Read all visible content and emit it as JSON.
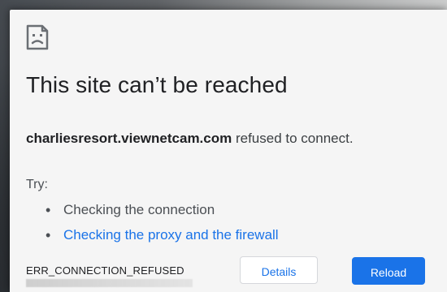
{
  "error_page": {
    "icon": "sad-page-icon",
    "title": "This site can’t be reached",
    "host": "charliesresort.viewnetcam.com",
    "message_suffix": " refused to connect.",
    "try_label": "Try:",
    "suggestions": [
      "Checking the connection",
      "Checking the proxy and the firewall"
    ],
    "error_code": "ERR_CONNECTION_REFUSED",
    "details_button": "Details",
    "reload_button": "Reload"
  },
  "colors": {
    "page_background": "#f5f5f5",
    "link": "#1a73e8",
    "title_text": "#202124",
    "body_text": "#4b4f54",
    "reload_button": "#1a73e8",
    "details_border": "#d5d7db"
  }
}
